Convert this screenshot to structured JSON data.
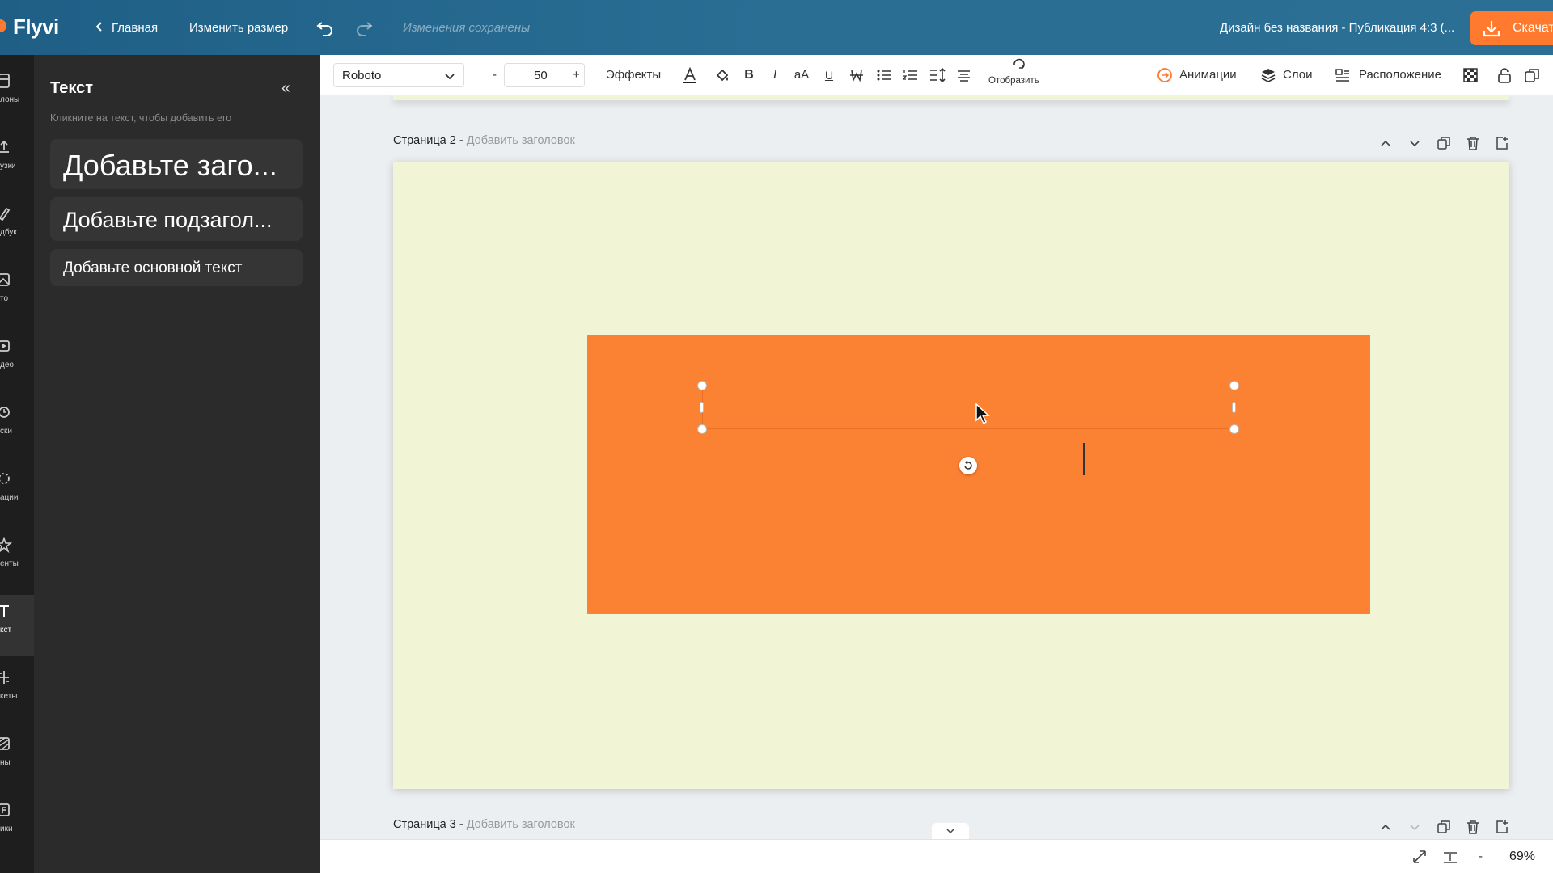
{
  "app": {
    "logo": "Flyvi"
  },
  "topbar": {
    "back_label": "Главная",
    "resize_label": "Изменить размер",
    "saved_status": "Изменения сохранены",
    "design_title": "Дизайн без названия - Публикация 4:3 (...",
    "download_label": "Скачат"
  },
  "rail": {
    "items": [
      {
        "label": "лоны",
        "icon": "template-icon"
      },
      {
        "label": "узки",
        "icon": "upload-icon"
      },
      {
        "label": "дбук",
        "icon": "brandbook-icon"
      },
      {
        "label": "то",
        "icon": "photo-icon"
      },
      {
        "label": "део",
        "icon": "video-icon"
      },
      {
        "label": "ски",
        "icon": "masks-icon"
      },
      {
        "label": "ации",
        "icon": "animation-icon"
      },
      {
        "label": "енты",
        "icon": "elements-icon"
      },
      {
        "label": "кст",
        "icon": "text-icon"
      },
      {
        "label": "кеты",
        "icon": "layouts-icon"
      },
      {
        "label": "ны",
        "icon": "backgrounds-icon"
      },
      {
        "label": "ики",
        "icon": "charts-icon"
      }
    ]
  },
  "panel": {
    "title": "Текст",
    "collapse": "«",
    "hint": "Кликните на текст, чтобы добавить его",
    "presets": {
      "heading": "Добавьте заго...",
      "subheading": "Добавьте подзагол...",
      "body": "Добавьте основной текст"
    }
  },
  "toolbar": {
    "font": "Roboto",
    "size_minus": "-",
    "size": "50",
    "size_plus": "+",
    "effects": "Эффекты",
    "mirror": "Отобразить",
    "animations": "Анимации",
    "layers": "Слои",
    "arrange": "Расположение"
  },
  "canvas": {
    "page2_label": "Страница 2 -",
    "page2_hint": "Добавить заголовок",
    "page3_label": "Страница 3 -",
    "page3_hint": "Добавить заголовок",
    "background_color": "#f1f5d6",
    "shape_color": "#fb8133"
  },
  "statusbar": {
    "zoom_minus": "-",
    "zoom": "69%"
  }
}
